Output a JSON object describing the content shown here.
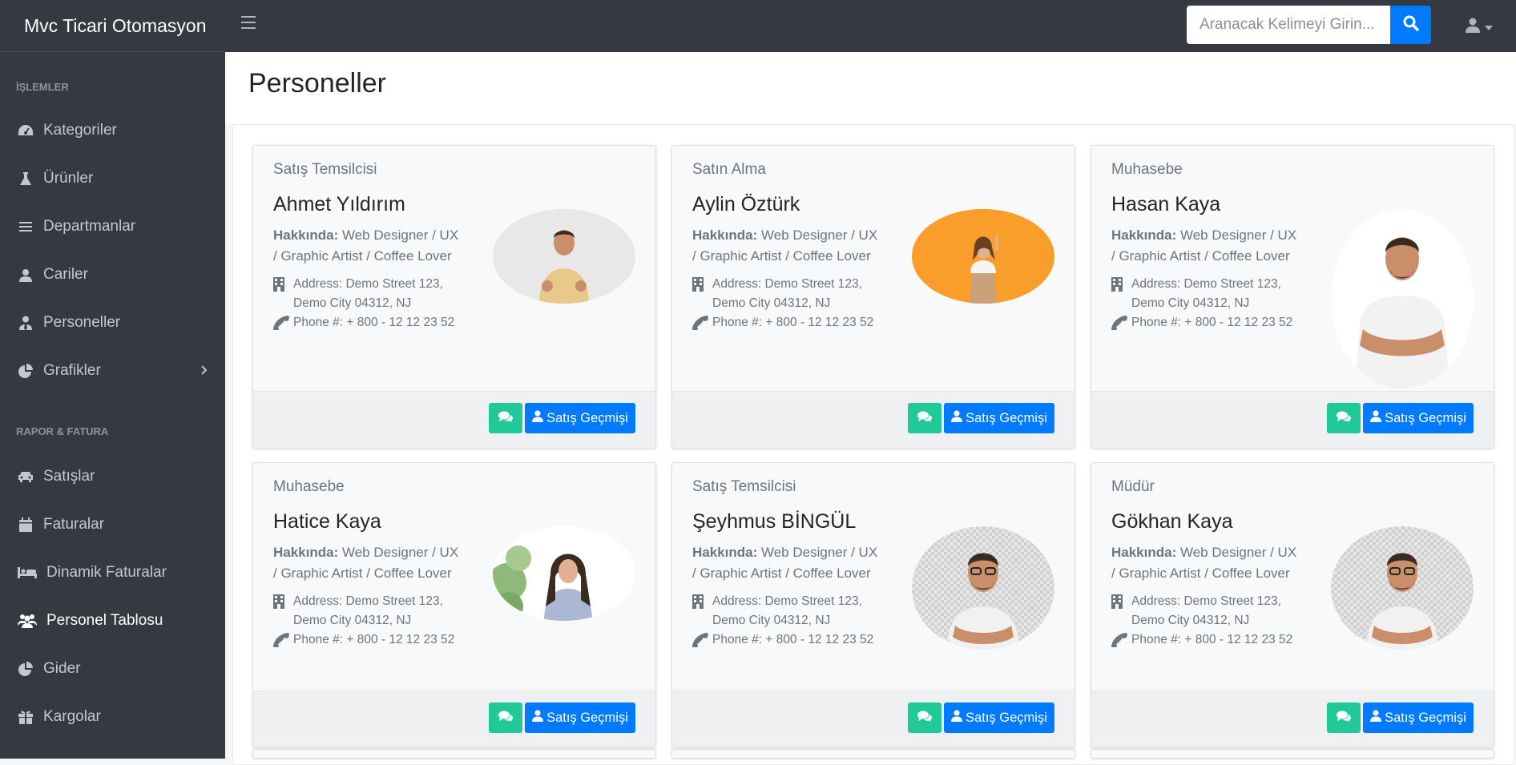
{
  "app": {
    "title": "Mvc Ticari Otomasyon"
  },
  "search": {
    "placeholder": "Aranacak Kelimeyi Girin..."
  },
  "sidebar": {
    "section1": "İŞLEMLER",
    "items1": [
      {
        "label": "Kategoriler",
        "icon": "dashboard-icon"
      },
      {
        "label": "Ürünler",
        "icon": "flask-icon"
      },
      {
        "label": "Departmanlar",
        "icon": "list-icon"
      },
      {
        "label": "Cariler",
        "icon": "user-icon"
      },
      {
        "label": "Personeller",
        "icon": "user-tie-icon"
      },
      {
        "label": "Grafikler",
        "icon": "chart-pie-icon"
      }
    ],
    "section2": "RAPOR & FATURA",
    "items2": [
      {
        "label": "Satışlar",
        "icon": "car-icon"
      },
      {
        "label": "Faturalar",
        "icon": "calendar-icon"
      },
      {
        "label": "Dinamik Faturalar",
        "icon": "bed-icon"
      },
      {
        "label": "Personel Tablosu",
        "icon": "users-icon",
        "active": true
      },
      {
        "label": "Gider",
        "icon": "chart-pie-icon"
      },
      {
        "label": "Kargolar",
        "icon": "gift-icon"
      }
    ]
  },
  "page": {
    "title": "Personeller"
  },
  "common": {
    "about_label": "Hakkında:",
    "about_text": "Web Designer / UX / Graphic Artist / Coffee Lover",
    "address": "Address: Demo Street 123, Demo City 04312, NJ",
    "phone": "Phone #: + 800 - 12 12 23 52",
    "history_button": "Satış Geçmişi"
  },
  "personnel": [
    {
      "department": "Satış Temsilcisi",
      "name": "Ahmet Yıldırım"
    },
    {
      "department": "Satın Alma",
      "name": "Aylin Öztürk"
    },
    {
      "department": "Muhasebe",
      "name": "Hasan Kaya"
    },
    {
      "department": "Muhasebe",
      "name": "Hatice Kaya"
    },
    {
      "department": "Satış Temsilcisi",
      "name": "Şeyhmus BİNGÜL"
    },
    {
      "department": "Müdür",
      "name": "Gökhan Kaya"
    }
  ],
  "colors": {
    "sidebar": "#343a40",
    "primary": "#007bff",
    "success": "#20c997"
  }
}
